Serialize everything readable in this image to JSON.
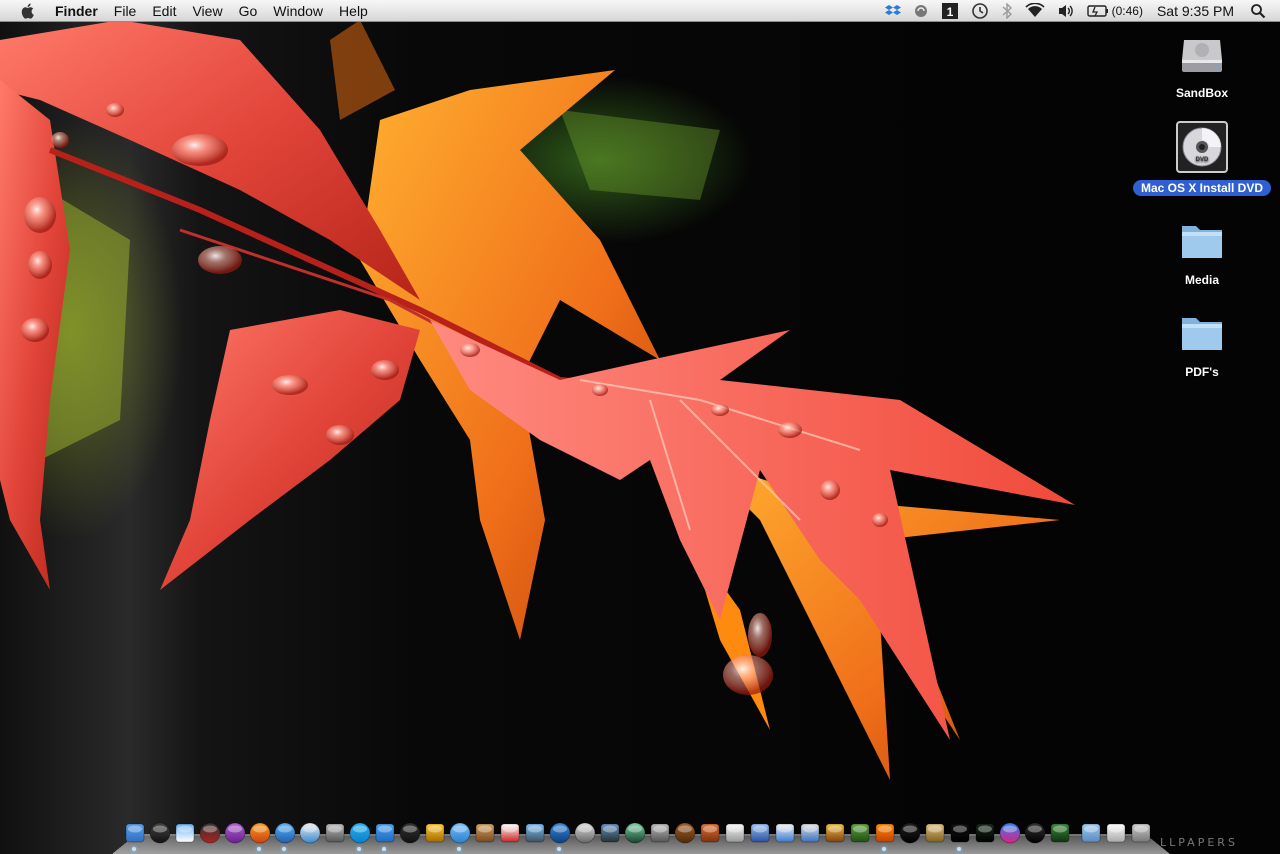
{
  "menubar": {
    "app_name": "Finder",
    "menus": [
      "File",
      "Edit",
      "View",
      "Go",
      "Window",
      "Help"
    ],
    "status_icons": [
      "dropbox-icon",
      "sync-icon",
      "bootcamp-icon",
      "time-machine-icon",
      "bluetooth-icon",
      "wifi-icon",
      "volume-icon",
      "battery-icon",
      "spotlight-icon"
    ],
    "battery_time": "(0:46)",
    "clock": "Sat 9:35 PM"
  },
  "desktop_icons": [
    {
      "label": "SandBox",
      "icon": "hard-drive-icon",
      "selected": false
    },
    {
      "label": "Mac OS X Install DVD",
      "icon": "dvd-icon",
      "selected": true
    },
    {
      "label": "Media",
      "icon": "folder-icon",
      "selected": false
    },
    {
      "label": "PDF's",
      "icon": "folder-icon",
      "selected": false
    }
  ],
  "dock": {
    "items": [
      "finder",
      "dashboard",
      "preview",
      "photo-booth",
      "itunes-alt",
      "firefox",
      "safari",
      "directions",
      "screen-sharing",
      "skype",
      "dropbox",
      "camera",
      "grand-central",
      "ichat",
      "address-book",
      "ical",
      "iphoto",
      "itunes",
      "dvd-player",
      "spaces",
      "time-machine",
      "system-preferences",
      "coconut",
      "presentation",
      "textedit",
      "xcode",
      "keynote-chart",
      "disk-utility",
      "garageband",
      "cocoa",
      "vlc",
      "quicktime",
      "shot",
      "terminal",
      "activity-monitor",
      "flickr",
      "x11",
      "preview2",
      "folder",
      "document",
      "trash"
    ],
    "running": [
      "finder",
      "firefox",
      "safari",
      "skype",
      "dropbox",
      "ichat",
      "itunes",
      "vlc",
      "terminal"
    ]
  },
  "watermark": "LLPAPERS"
}
